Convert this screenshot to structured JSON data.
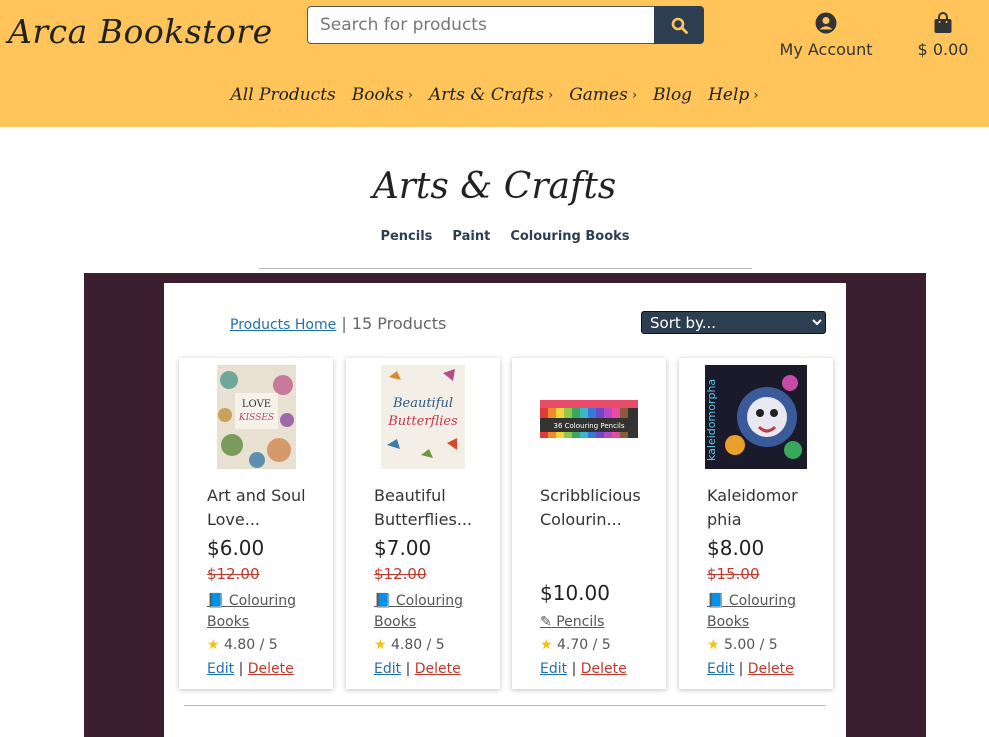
{
  "header": {
    "logo": "Arca Bookstore",
    "search_placeholder": "Search for products",
    "account_label": "My Account",
    "cart_total": "$ 0.00"
  },
  "nav": [
    {
      "label": "All Products",
      "chevron": false
    },
    {
      "label": "Books",
      "chevron": true
    },
    {
      "label": "Arts & Crafts",
      "chevron": true
    },
    {
      "label": "Games",
      "chevron": true
    },
    {
      "label": "Blog",
      "chevron": false
    },
    {
      "label": "Help",
      "chevron": true
    }
  ],
  "category": {
    "title": "Arts & Crafts",
    "subcategories": [
      "Pencils",
      "Paint",
      "Colouring Books"
    ]
  },
  "listing": {
    "breadcrumb_link": "Products Home",
    "separator": "|",
    "count": "15 Products",
    "sort_label": "Sort by..."
  },
  "products": [
    {
      "title": "Art and Soul Love...",
      "price": "$6.00",
      "old_price": "$12.00",
      "category": "Colouring Books",
      "category_icon": "book-icon",
      "rating": "4.80 / 5",
      "edit": "Edit",
      "delete": "Delete"
    },
    {
      "title": "Beautiful Butterflies...",
      "price": "$7.00",
      "old_price": "$12.00",
      "category": "Colouring Books",
      "category_icon": "book-icon",
      "rating": "4.80 / 5",
      "edit": "Edit",
      "delete": "Delete"
    },
    {
      "title": "Scribblicious Colourin...",
      "price": "$10.00",
      "old_price": "",
      "category": "Pencils",
      "category_icon": "pencil-icon",
      "rating": "4.70 / 5",
      "edit": "Edit",
      "delete": "Delete"
    },
    {
      "title": "Kaleidomorphia",
      "price": "$8.00",
      "old_price": "$15.00",
      "category": "Colouring Books",
      "category_icon": "book-icon",
      "rating": "5.00 / 5",
      "edit": "Edit",
      "delete": "Delete"
    }
  ],
  "colors": {
    "header_bg": "#ffc55a",
    "panel_bg": "#3b1f31",
    "accent": "#2c3e50",
    "link": "#1f6fb5",
    "danger": "#c0392b"
  }
}
